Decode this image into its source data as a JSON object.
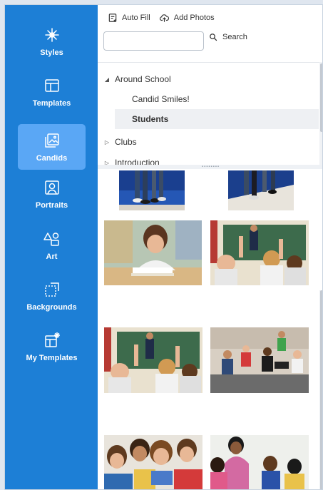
{
  "sidebar": {
    "items": [
      {
        "label": "Styles",
        "icon": "styles-icon"
      },
      {
        "label": "Templates",
        "icon": "templates-icon"
      },
      {
        "label": "Candids",
        "icon": "candids-icon",
        "active": true
      },
      {
        "label": "Portraits",
        "icon": "portraits-icon"
      },
      {
        "label": "Art",
        "icon": "art-icon"
      },
      {
        "label": "Backgrounds",
        "icon": "backgrounds-icon"
      },
      {
        "label": "My Templates",
        "icon": "my-templates-icon"
      }
    ]
  },
  "toolbar": {
    "auto_fill_label": "Auto Fill",
    "add_photos_label": "Add Photos"
  },
  "search": {
    "value": "",
    "placeholder": "",
    "button_label": "Search"
  },
  "tree": {
    "items": [
      {
        "label": "Around School",
        "expanded": true
      },
      {
        "label": "Candid Smiles!"
      },
      {
        "label": "Students",
        "selected": true
      },
      {
        "label": "Clubs",
        "expanded": false
      },
      {
        "label": "Introduction",
        "expanded": false
      }
    ]
  },
  "photos": [
    {
      "name": "students-legs-photo-1"
    },
    {
      "name": "students-legs-photo-2"
    },
    {
      "name": "girl-writing-photo"
    },
    {
      "name": "classroom-hands-raised-photo-1"
    },
    {
      "name": "classroom-hands-raised-photo-2"
    },
    {
      "name": "school-band-photo"
    },
    {
      "name": "students-tablet-photo"
    },
    {
      "name": "teacher-with-students-photo"
    }
  ],
  "colors": {
    "sidebar_bg": "#1d7fd6",
    "sidebar_active": "#5aa7f5",
    "selected_row_bg": "#eef0f3"
  }
}
